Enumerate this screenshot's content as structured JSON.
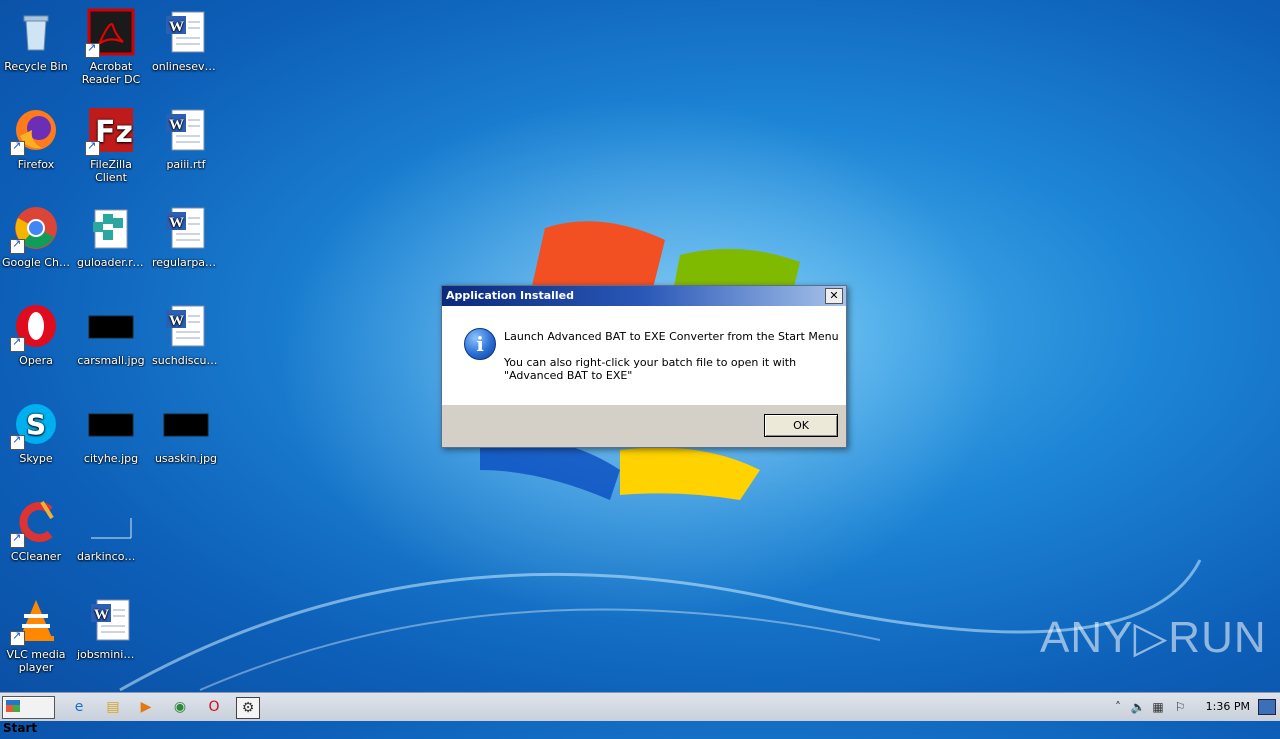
{
  "desktop_icons": [
    {
      "label": "Recycle Bin",
      "icon": "recycle-bin-icon"
    },
    {
      "label": "Acrobat Reader DC",
      "icon": "acrobat-icon"
    },
    {
      "label": "onlineseven....",
      "icon": "word-doc-icon"
    },
    {
      "label": "Firefox",
      "icon": "firefox-icon"
    },
    {
      "label": "FileZilla Client",
      "icon": "filezilla-icon"
    },
    {
      "label": "paiii.rtf",
      "icon": "word-doc-icon"
    },
    {
      "label": "Google Chrome",
      "icon": "chrome-icon"
    },
    {
      "label": "guloader.reg",
      "icon": "registry-file-icon"
    },
    {
      "label": "regularpass....",
      "icon": "word-doc-icon"
    },
    {
      "label": "Opera",
      "icon": "opera-icon"
    },
    {
      "label": "carsmall.jpg",
      "icon": "image-file-icon"
    },
    {
      "label": "suchdiscussi....",
      "icon": "word-doc-icon"
    },
    {
      "label": "Skype",
      "icon": "skype-icon"
    },
    {
      "label": "cityhe.jpg",
      "icon": "image-file-icon"
    },
    {
      "label": "usaskin.jpg",
      "icon": "image-file-icon"
    },
    {
      "label": "CCleaner",
      "icon": "ccleaner-icon"
    },
    {
      "label": "darkincome....",
      "icon": "blank-file-icon"
    },
    {
      "label": "VLC media player",
      "icon": "vlc-icon"
    },
    {
      "label": "jobsminimu....",
      "icon": "word-doc-icon"
    }
  ],
  "dialog": {
    "title": "Application Installed",
    "close_symbol": "✕",
    "message_1": "Launch Advanced BAT to EXE Converter from the Start Menu",
    "message_2": "You can also right-click your batch file to open it with \"Advanced BAT to EXE\"",
    "ok_label": "OK",
    "info_symbol": "i"
  },
  "watermark": {
    "text": "ANY▷RUN"
  },
  "taskbar": {
    "start_label": "Start",
    "pinned": [
      {
        "icon": "ie-icon",
        "glyph": "e"
      },
      {
        "icon": "explorer-icon",
        "glyph": "▤"
      },
      {
        "icon": "media-player-icon",
        "glyph": "▶"
      },
      {
        "icon": "chrome-icon",
        "glyph": "◉"
      },
      {
        "icon": "opera-icon",
        "glyph": "O"
      },
      {
        "icon": "installer-icon",
        "glyph": "⚙"
      }
    ],
    "tray_icons": [
      "show-hidden-icon",
      "volume-icon",
      "network-icon",
      "action-center-flag-icon"
    ],
    "tray_glyphs": [
      "˄",
      "🔈",
      "▦",
      "⚐"
    ],
    "clock": "1:36 PM"
  }
}
